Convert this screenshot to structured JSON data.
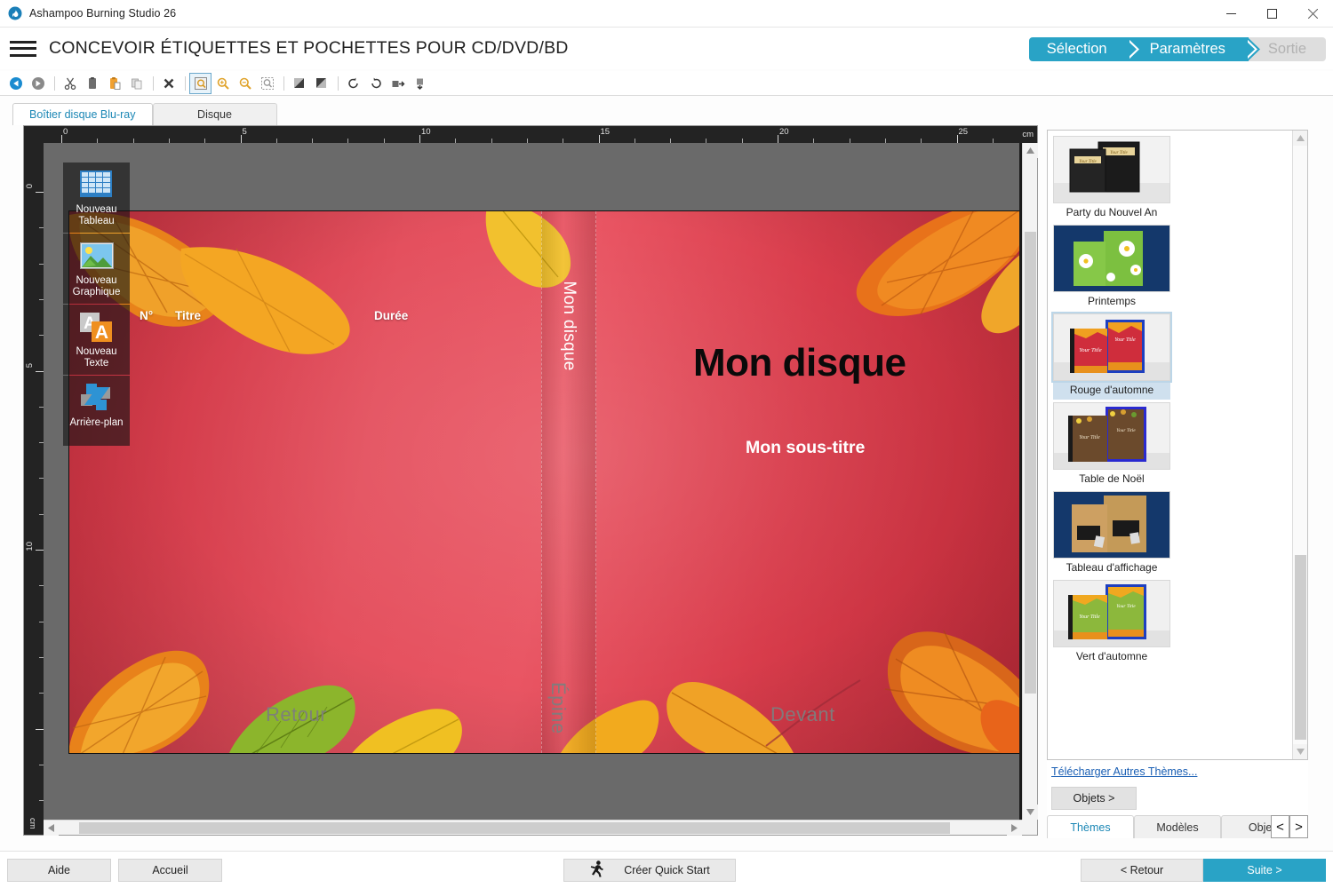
{
  "window": {
    "title": "Ashampoo Burning Studio 26",
    "icon": "ashampoo-flame-icon",
    "controls": [
      {
        "name": "minimize-button",
        "glyph": "minimize-icon"
      },
      {
        "name": "maximize-button",
        "glyph": "maximize-icon"
      },
      {
        "name": "close-button",
        "glyph": "close-icon"
      }
    ]
  },
  "header": {
    "menu_icon": "hamburger-menu-icon",
    "title": "CONCEVOIR ÉTIQUETTES ET POCHETTES POUR CD/DVD/BD"
  },
  "steps": [
    {
      "label": "Sélection",
      "state": "done"
    },
    {
      "label": "Paramètres",
      "state": "active"
    },
    {
      "label": "Sortie",
      "state": "disabled"
    }
  ],
  "colors": {
    "accent": "#29a3c6",
    "step_inactive": "#dedede",
    "link": "#1a5fb4",
    "tab_active_text": "#1b87b5",
    "canvas_bg": "#6a6a6a",
    "ruler_bg": "#232323"
  },
  "toolbar": {
    "items": [
      {
        "name": "undo-icon",
        "title": "Annuler"
      },
      {
        "name": "redo-icon",
        "title": "Rétablir"
      },
      {
        "name": "cut-icon",
        "title": "Couper"
      },
      {
        "name": "copy-icon",
        "title": "Copier"
      },
      {
        "name": "paste-icon",
        "title": "Coller"
      },
      {
        "name": "duplicate-icon",
        "title": "Dupliquer"
      },
      {
        "name": "delete-icon",
        "title": "Supprimer"
      },
      {
        "name": "zoom-fit-icon",
        "title": "Ajuster"
      },
      {
        "name": "zoom-in-icon",
        "title": "Agrandir"
      },
      {
        "name": "zoom-out-icon",
        "title": "Réduire"
      },
      {
        "name": "zoom-selection-icon",
        "title": "Zoom sélection"
      },
      {
        "name": "flip-horizontal-icon",
        "title": "Miroir horizontal"
      },
      {
        "name": "flip-vertical-icon",
        "title": "Miroir vertical"
      },
      {
        "name": "rotate-ccw-icon",
        "title": "Rotation gauche"
      },
      {
        "name": "rotate-cw-icon",
        "title": "Rotation droite"
      },
      {
        "name": "send-backward-icon",
        "title": "Arrière"
      },
      {
        "name": "bring-forward-icon",
        "title": "Avant"
      }
    ]
  },
  "canvas_tabs": [
    {
      "label": "Boîtier disque Blu-ray",
      "active": true
    },
    {
      "label": "Disque",
      "active": false
    }
  ],
  "palette": [
    {
      "label_line1": "Nouveau",
      "label_line2": "Tableau",
      "icon": "new-table-icon"
    },
    {
      "label_line1": "Nouveau",
      "label_line2": "Graphique",
      "icon": "new-image-icon"
    },
    {
      "label_line1": "Nouveau",
      "label_line2": "Texte",
      "icon": "new-text-icon"
    },
    {
      "label_line1": "Arrière-plan",
      "label_line2": "",
      "icon": "background-icon"
    }
  ],
  "ruler": {
    "unit": "cm",
    "h_labels": [
      "0",
      "5",
      "10",
      "15",
      "20",
      "25"
    ],
    "v_labels": [
      "0",
      "5",
      "10"
    ]
  },
  "cover": {
    "table_headers": {
      "num": "N°",
      "title": "Titre",
      "duration": "Durée"
    },
    "disc_title": "Mon disque",
    "disc_subtitle": "Mon sous-titre",
    "spine_title": "Mon disque",
    "watermarks": {
      "back": "Retour",
      "spine": "Épine",
      "front": "Devant"
    }
  },
  "themes": {
    "items": [
      {
        "name": "Party du Nouvel An",
        "selected": false
      },
      {
        "name": "Printemps",
        "selected": false
      },
      {
        "name": "Rouge d'automne",
        "selected": true
      },
      {
        "name": "Table de Noël",
        "selected": false
      },
      {
        "name": "Tableau d'affichage",
        "selected": false
      },
      {
        "name": "Vert d'automne",
        "selected": false
      }
    ],
    "thumb_placeholder": "Your Title",
    "download_link": "Télécharger Autres Thèmes...",
    "objects_button": "Objets >"
  },
  "panel_tabs": [
    {
      "label": "Thèmes",
      "active": true
    },
    {
      "label": "Modèles",
      "active": false
    },
    {
      "label": "Objets",
      "active": false
    }
  ],
  "panel_nav": {
    "prev": "<",
    "next": ">"
  },
  "bottom": {
    "help": "Aide",
    "home": "Accueil",
    "quickstart": "Créer Quick Start",
    "quickstart_icon": "runner-icon",
    "back": "< Retour",
    "next": "Suite >"
  }
}
